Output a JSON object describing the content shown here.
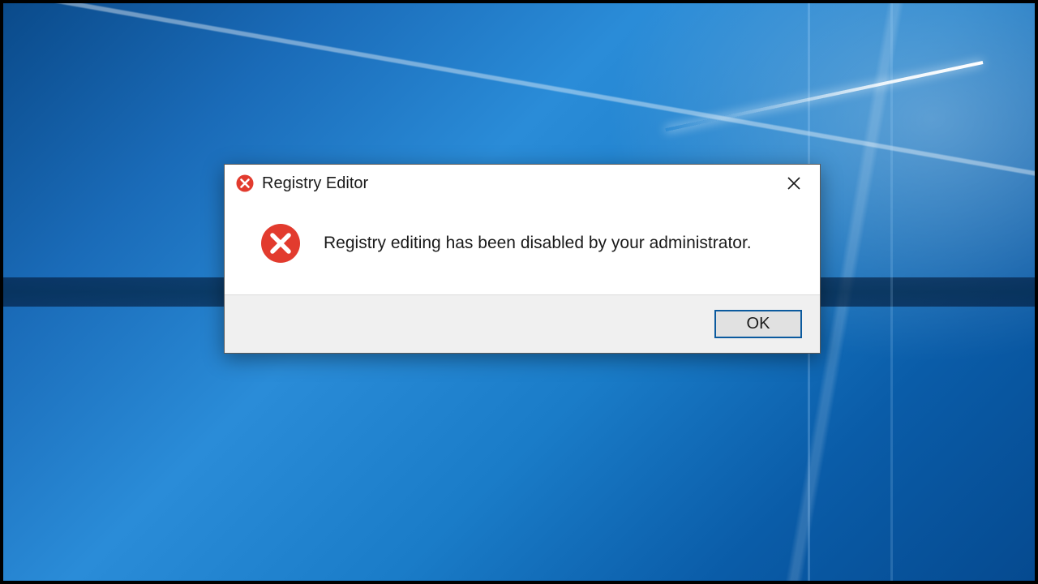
{
  "dialog": {
    "title": "Registry Editor",
    "message": "Registry editing has been disabled by your administrator.",
    "ok_label": "OK"
  },
  "icons": {
    "title_icon": "error-icon",
    "body_icon": "error-icon",
    "close_icon": "close-icon"
  },
  "colors": {
    "error_red": "#e23b2e",
    "button_border": "#0b5a9e",
    "footer_bg": "#f0f0f0"
  }
}
